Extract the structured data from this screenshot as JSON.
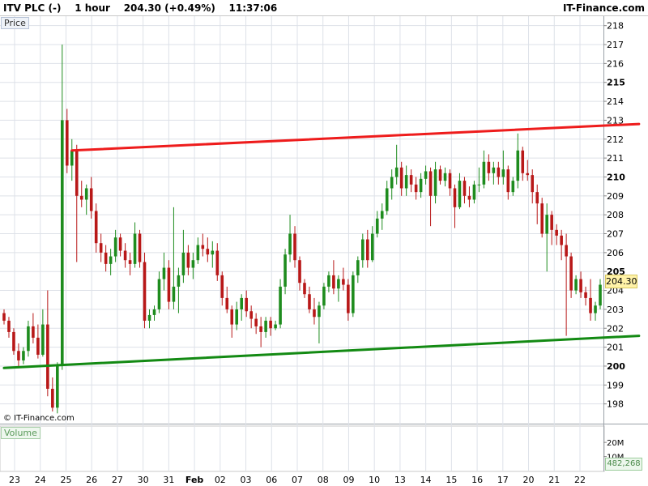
{
  "header": {
    "title": "ITV PLC (-)    1 hour    204.30 (+0.49%)    11:37:06",
    "brand": "IT-Finance.com"
  },
  "panels": {
    "price_label": "Price",
    "volume_label": "Volume",
    "copyright": "© IT-Finance.com",
    "last_price": "204.30",
    "last_volume": "482,268"
  },
  "colors": {
    "up_candle": "#1e8c1e",
    "down_candle": "#b81818",
    "resistance": "#ee1c1c",
    "support": "#138a13",
    "grid": "#dde1e8"
  },
  "chart_data": {
    "type": "candlestick",
    "symbol": "ITV PLC",
    "interval": "1 hour",
    "ylim": [
      197,
      218.5
    ],
    "y_ticks": [
      198,
      199,
      200,
      201,
      202,
      203,
      204,
      205,
      206,
      207,
      208,
      209,
      210,
      211,
      212,
      213,
      214,
      215,
      216,
      217,
      218
    ],
    "y_ticks_bold": [
      200,
      205,
      210,
      215
    ],
    "x_tick_labels": [
      "23",
      "24",
      "25",
      "26",
      "27",
      "30",
      "31",
      "Feb",
      "02",
      "03",
      "06",
      "07",
      "08",
      "09",
      "10",
      "13",
      "14",
      "15",
      "16",
      "17",
      "20",
      "21",
      "22"
    ],
    "ohlc": [
      [
        202.8,
        203.0,
        202.2,
        202.4
      ],
      [
        202.4,
        202.6,
        201.5,
        201.8
      ],
      [
        201.8,
        202.0,
        200.6,
        200.8
      ],
      [
        200.8,
        201.2,
        199.9,
        200.3
      ],
      [
        200.3,
        201.0,
        200.1,
        200.8
      ],
      [
        200.8,
        202.4,
        200.5,
        202.1
      ],
      [
        202.1,
        202.8,
        201.2,
        201.5
      ],
      [
        201.5,
        202.2,
        200.4,
        200.6
      ],
      [
        200.6,
        203.0,
        200.5,
        202.2
      ],
      [
        202.2,
        204.0,
        198.4,
        198.8
      ],
      [
        198.8,
        199.4,
        197.6,
        197.8
      ],
      [
        197.8,
        200.2,
        197.5,
        200.0
      ],
      [
        200.0,
        217.0,
        199.8,
        213.0
      ],
      [
        213.0,
        213.6,
        210.2,
        210.6
      ],
      [
        210.6,
        212.0,
        209.8,
        211.4
      ],
      [
        211.4,
        211.7,
        205.5,
        209.0
      ],
      [
        209.0,
        209.8,
        208.4,
        208.8
      ],
      [
        208.8,
        209.6,
        208.0,
        209.4
      ],
      [
        209.4,
        210.0,
        207.8,
        208.2
      ],
      [
        208.2,
        208.6,
        206.0,
        206.5
      ],
      [
        206.5,
        207.0,
        205.5,
        206.0
      ],
      [
        206.0,
        206.4,
        205.0,
        205.4
      ],
      [
        205.4,
        206.2,
        204.8,
        205.8
      ],
      [
        205.8,
        207.2,
        205.5,
        206.8
      ],
      [
        206.8,
        207.0,
        205.8,
        206.1
      ],
      [
        206.1,
        206.5,
        205.2,
        205.6
      ],
      [
        205.6,
        206.0,
        204.8,
        205.4
      ],
      [
        205.4,
        207.6,
        205.2,
        207.0
      ],
      [
        207.0,
        207.2,
        205.2,
        205.5
      ],
      [
        205.5,
        206.0,
        202.0,
        202.4
      ],
      [
        202.4,
        203.0,
        202.0,
        202.7
      ],
      [
        202.7,
        203.2,
        202.4,
        203.0
      ],
      [
        203.0,
        205.0,
        202.8,
        204.6
      ],
      [
        204.6,
        206.0,
        204.0,
        205.2
      ],
      [
        205.2,
        205.6,
        203.0,
        203.4
      ],
      [
        203.4,
        208.4,
        203.0,
        204.2
      ],
      [
        204.2,
        205.2,
        202.8,
        204.8
      ],
      [
        204.8,
        207.2,
        204.4,
        206.0
      ],
      [
        206.0,
        206.4,
        204.8,
        205.2
      ],
      [
        205.2,
        206.0,
        204.6,
        205.6
      ],
      [
        205.6,
        206.8,
        205.4,
        206.4
      ],
      [
        206.4,
        207.0,
        205.8,
        206.2
      ],
      [
        206.2,
        206.8,
        205.5,
        205.9
      ],
      [
        205.9,
        206.6,
        205.2,
        206.1
      ],
      [
        206.1,
        206.5,
        204.5,
        204.8
      ],
      [
        204.8,
        205.0,
        203.2,
        203.6
      ],
      [
        203.6,
        204.2,
        202.8,
        203.0
      ],
      [
        203.0,
        203.2,
        201.5,
        202.2
      ],
      [
        202.2,
        203.4,
        201.9,
        203.0
      ],
      [
        203.0,
        203.8,
        202.4,
        203.6
      ],
      [
        203.6,
        204.0,
        202.6,
        202.9
      ],
      [
        202.9,
        203.2,
        202.0,
        202.5
      ],
      [
        202.5,
        202.8,
        201.7,
        202.1
      ],
      [
        202.1,
        202.6,
        201.0,
        201.8
      ],
      [
        201.8,
        202.6,
        201.5,
        202.4
      ],
      [
        202.4,
        202.6,
        201.6,
        202.0
      ],
      [
        202.0,
        202.4,
        201.9,
        202.2
      ],
      [
        202.2,
        204.6,
        202.0,
        204.2
      ],
      [
        204.2,
        206.2,
        203.8,
        205.9
      ],
      [
        205.9,
        208.0,
        205.5,
        207.0
      ],
      [
        207.0,
        207.4,
        205.2,
        205.6
      ],
      [
        205.6,
        205.8,
        204.0,
        204.4
      ],
      [
        204.4,
        204.6,
        203.6,
        203.8
      ],
      [
        203.8,
        204.2,
        202.8,
        203.0
      ],
      [
        203.0,
        203.6,
        202.2,
        202.6
      ],
      [
        202.6,
        203.4,
        201.2,
        203.2
      ],
      [
        203.2,
        204.4,
        203.0,
        204.2
      ],
      [
        204.2,
        205.0,
        203.9,
        204.8
      ],
      [
        204.8,
        205.6,
        203.8,
        204.1
      ],
      [
        204.1,
        204.8,
        203.4,
        204.6
      ],
      [
        204.6,
        205.2,
        204.0,
        204.3
      ],
      [
        204.3,
        204.6,
        202.4,
        202.8
      ],
      [
        202.8,
        205.0,
        202.6,
        204.8
      ],
      [
        204.8,
        205.8,
        204.4,
        205.6
      ],
      [
        205.6,
        207.0,
        205.2,
        206.7
      ],
      [
        206.7,
        207.2,
        205.2,
        205.6
      ],
      [
        205.6,
        207.4,
        205.5,
        207.0
      ],
      [
        207.0,
        208.2,
        206.8,
        207.8
      ],
      [
        207.8,
        208.6,
        207.2,
        208.2
      ],
      [
        208.2,
        209.8,
        208.0,
        209.4
      ],
      [
        209.4,
        210.4,
        208.8,
        210.0
      ],
      [
        210.0,
        211.7,
        209.6,
        210.5
      ],
      [
        210.5,
        210.8,
        209.0,
        209.4
      ],
      [
        209.4,
        210.6,
        209.0,
        210.1
      ],
      [
        210.1,
        210.4,
        209.2,
        209.6
      ],
      [
        209.6,
        210.0,
        208.8,
        209.2
      ],
      [
        209.2,
        210.2,
        208.9,
        209.9
      ],
      [
        209.9,
        210.6,
        209.6,
        210.3
      ],
      [
        210.3,
        210.5,
        207.4,
        209.0
      ],
      [
        209.0,
        210.8,
        208.6,
        210.4
      ],
      [
        210.4,
        210.6,
        209.6,
        209.8
      ],
      [
        209.8,
        210.5,
        209.5,
        210.2
      ],
      [
        210.2,
        210.4,
        209.0,
        209.4
      ],
      [
        209.4,
        209.6,
        207.3,
        208.4
      ],
      [
        208.4,
        210.2,
        208.3,
        209.8
      ],
      [
        209.8,
        210.0,
        208.6,
        209.0
      ],
      [
        209.0,
        209.5,
        208.4,
        208.8
      ],
      [
        208.8,
        209.8,
        208.6,
        209.6
      ],
      [
        209.6,
        210.5,
        209.2,
        209.6
      ],
      [
        209.6,
        211.4,
        209.4,
        210.8
      ],
      [
        210.8,
        211.2,
        209.8,
        210.2
      ],
      [
        210.2,
        210.8,
        209.6,
        210.5
      ],
      [
        210.5,
        210.8,
        209.6,
        210.0
      ],
      [
        210.0,
        211.4,
        209.6,
        210.4
      ],
      [
        210.4,
        210.6,
        208.8,
        209.2
      ],
      [
        209.2,
        210.0,
        209.0,
        209.8
      ],
      [
        209.8,
        212.3,
        209.4,
        211.4
      ],
      [
        211.4,
        211.6,
        209.8,
        210.2
      ],
      [
        210.2,
        210.9,
        209.8,
        210.1
      ],
      [
        210.1,
        210.4,
        208.6,
        209.2
      ],
      [
        209.2,
        209.6,
        207.5,
        208.6
      ],
      [
        208.6,
        208.9,
        206.8,
        207.0
      ],
      [
        207.0,
        208.6,
        205.0,
        208.0
      ],
      [
        208.0,
        208.2,
        206.4,
        207.2
      ],
      [
        207.2,
        207.5,
        206.4,
        206.9
      ],
      [
        206.9,
        207.2,
        205.6,
        206.4
      ],
      [
        206.4,
        207.0,
        201.6,
        205.8
      ],
      [
        205.8,
        206.0,
        203.6,
        204.0
      ],
      [
        204.0,
        204.8,
        203.8,
        204.6
      ],
      [
        204.6,
        205.0,
        203.6,
        203.9
      ],
      [
        203.9,
        204.2,
        203.2,
        203.6
      ],
      [
        203.6,
        204.6,
        202.4,
        202.8
      ],
      [
        202.8,
        203.4,
        202.4,
        203.2
      ],
      [
        203.2,
        204.6,
        203.0,
        204.3
      ]
    ],
    "volume_axis_ticks": [
      "10M",
      "20M"
    ],
    "volume_ylim": [
      0,
      31000000
    ],
    "volume_values": [],
    "trendlines": [
      {
        "role": "resistance",
        "color": "#ee1c1c",
        "points": [
          [
            14,
            211.4
          ],
          [
            131,
            212.8
          ]
        ]
      },
      {
        "role": "support",
        "color": "#138a13",
        "points": [
          [
            0,
            199.9
          ],
          [
            131,
            201.6
          ]
        ]
      }
    ],
    "grid": true
  }
}
